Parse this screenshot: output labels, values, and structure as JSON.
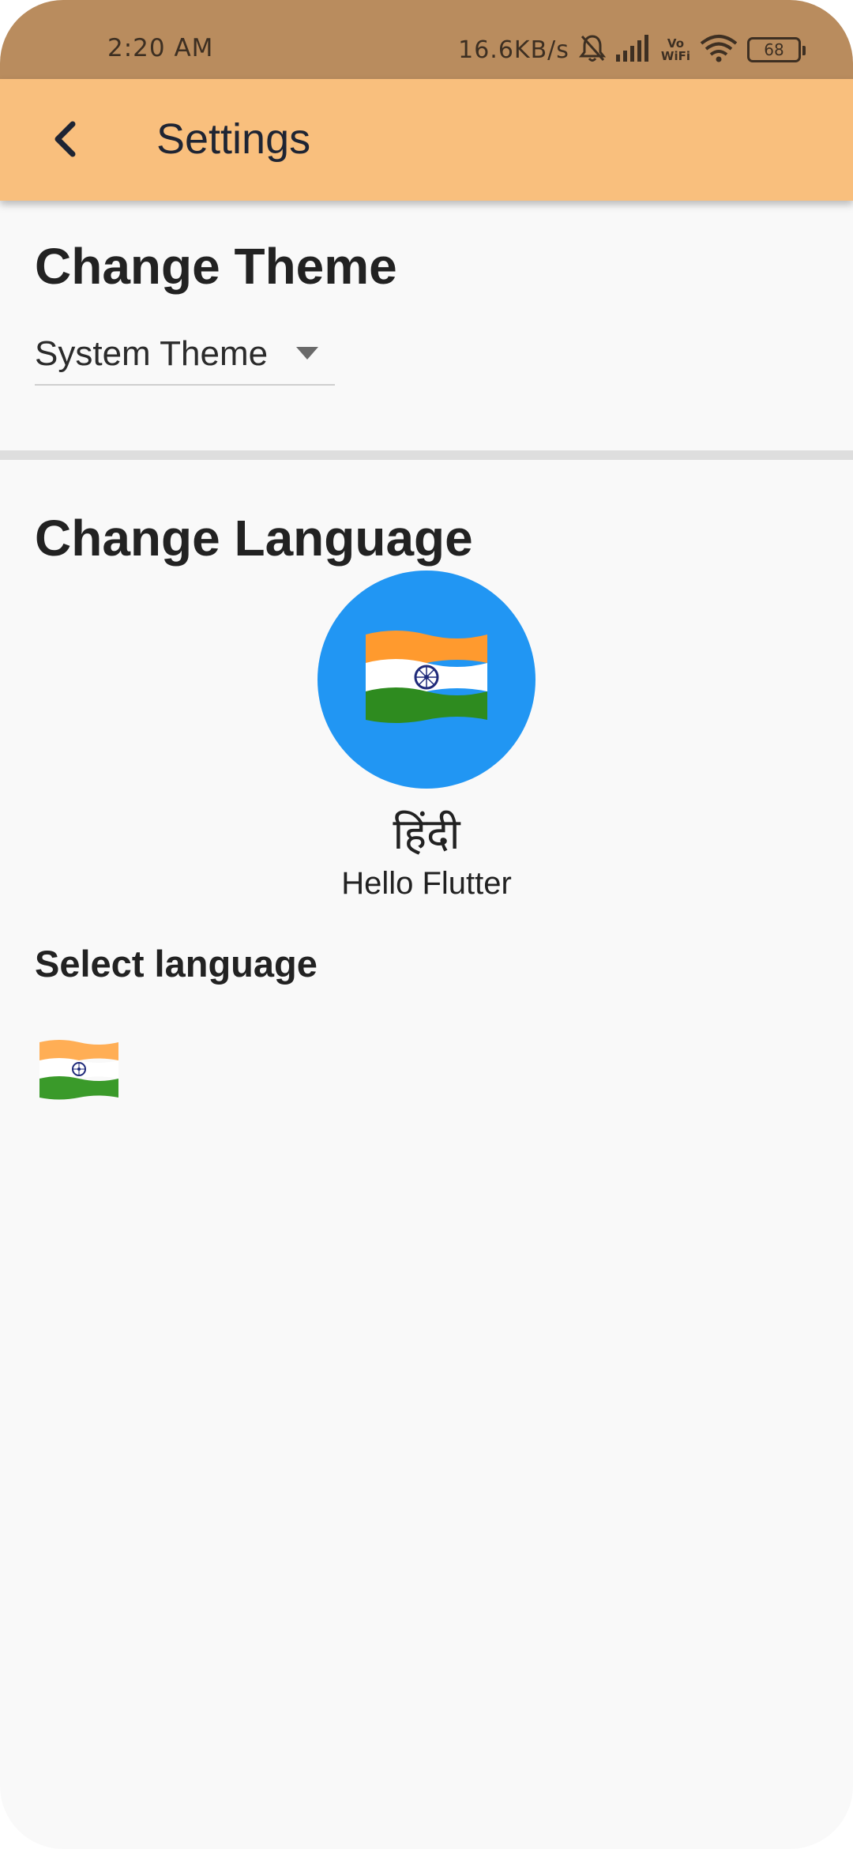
{
  "status_bar": {
    "time": "2:20 AM",
    "net_speed": "16.6KB/s",
    "vowifi_top": "Vo",
    "vowifi_bottom": "WiFi",
    "battery_level": "68",
    "icons": [
      "bell-muted-icon",
      "signal-icon",
      "vowifi-icon",
      "wifi-icon",
      "battery-icon"
    ]
  },
  "app_bar": {
    "title": "Settings",
    "back_icon": "back-arrow-icon",
    "color": "#f9bf7d"
  },
  "theme_section": {
    "title": "Change Theme",
    "selected_theme": "System Theme"
  },
  "language_section": {
    "title": "Change Language",
    "current_language": {
      "flag_icon": "india-flag-icon",
      "native_name": "हिंदी",
      "greeting": "Hello Flutter",
      "avatar_color": "#2196f3"
    },
    "select_label": "Select language",
    "options": [
      {
        "flag_icon": "india-flag-icon"
      }
    ]
  }
}
